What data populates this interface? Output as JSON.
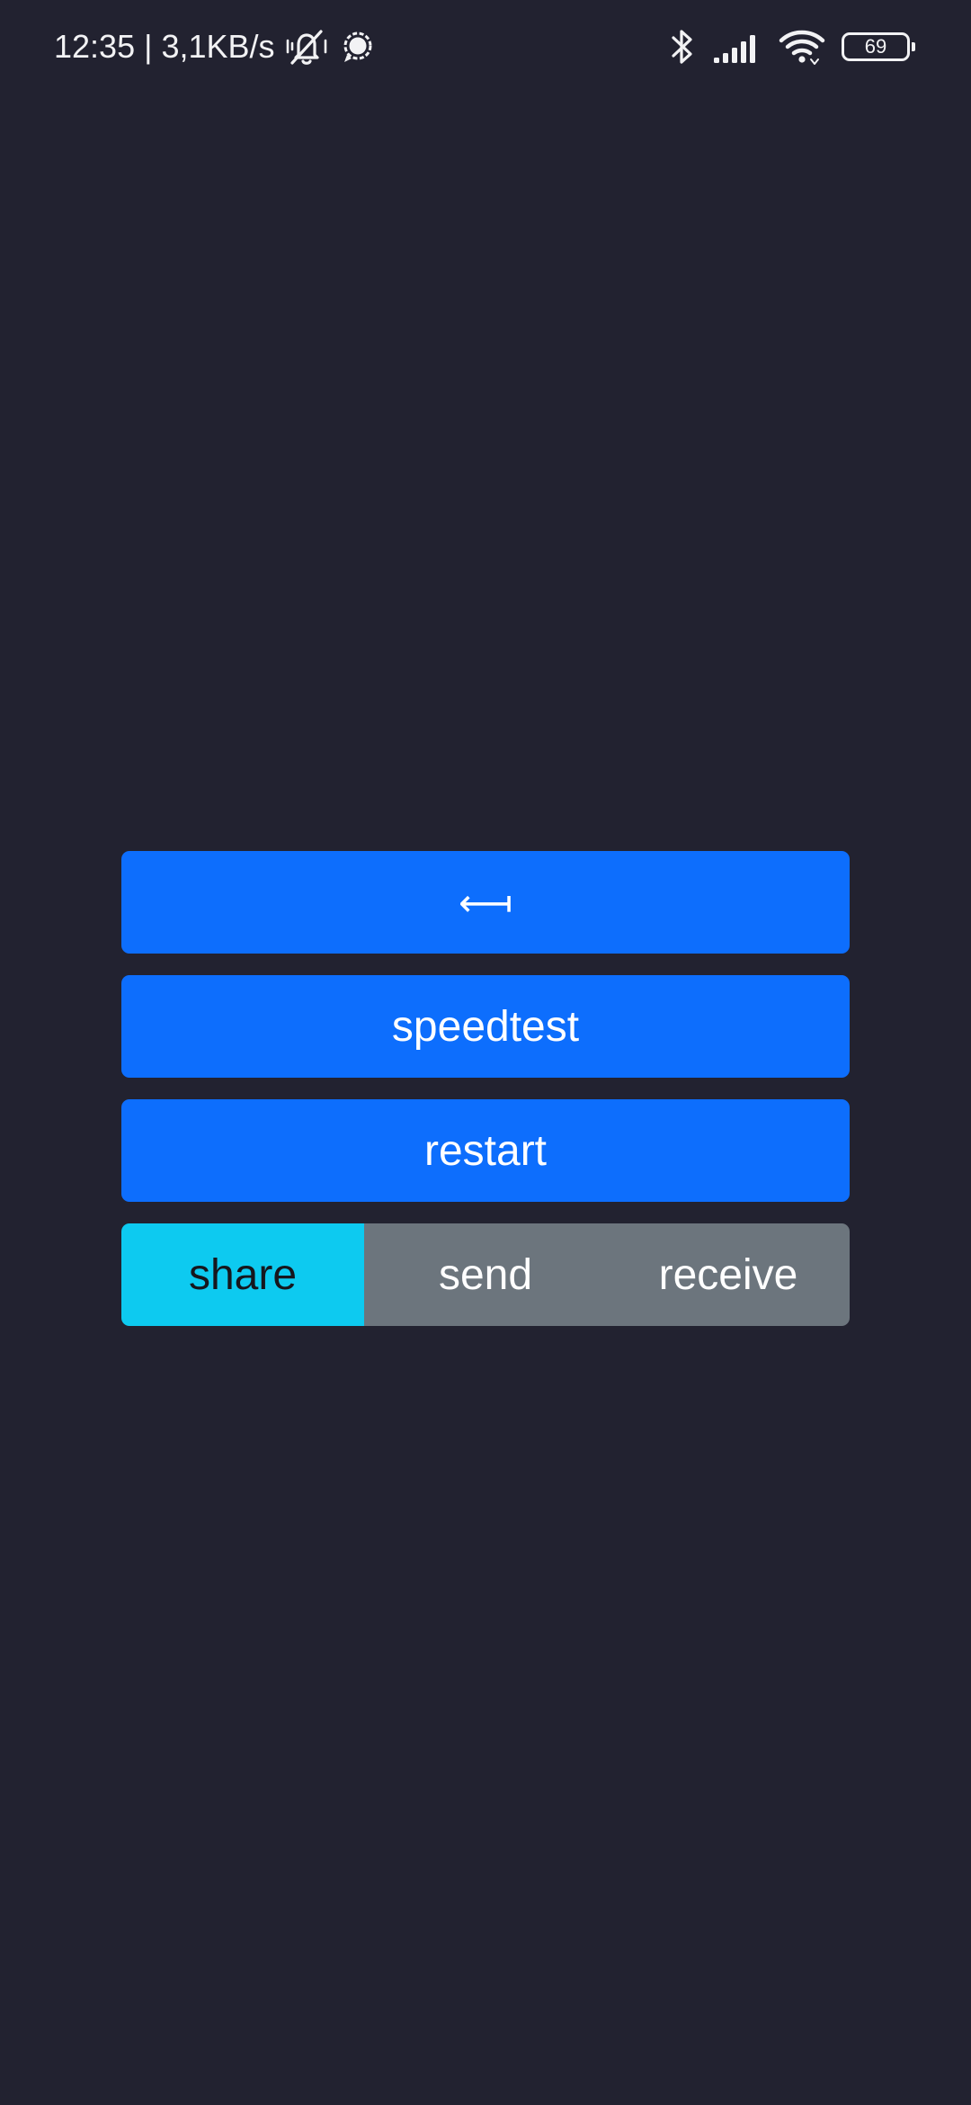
{
  "status_bar": {
    "time_and_speed": "12:35 | 3,1KB/s",
    "battery_level": "69",
    "icons": [
      "muted-bell-icon",
      "chat-bubble-icon",
      "bluetooth-icon",
      "signal-icon",
      "wifi-icon",
      "battery-icon"
    ]
  },
  "controls": {
    "back_label": "⟻",
    "speedtest_label": "speedtest",
    "restart_label": "restart"
  },
  "mode_group": {
    "options": [
      "share",
      "send",
      "receive"
    ],
    "selected": "share"
  },
  "colors": {
    "background": "#222230",
    "primary": "#0d6efd",
    "active_segment": "#0dcaf0",
    "inactive_segment": "#6c757d"
  }
}
